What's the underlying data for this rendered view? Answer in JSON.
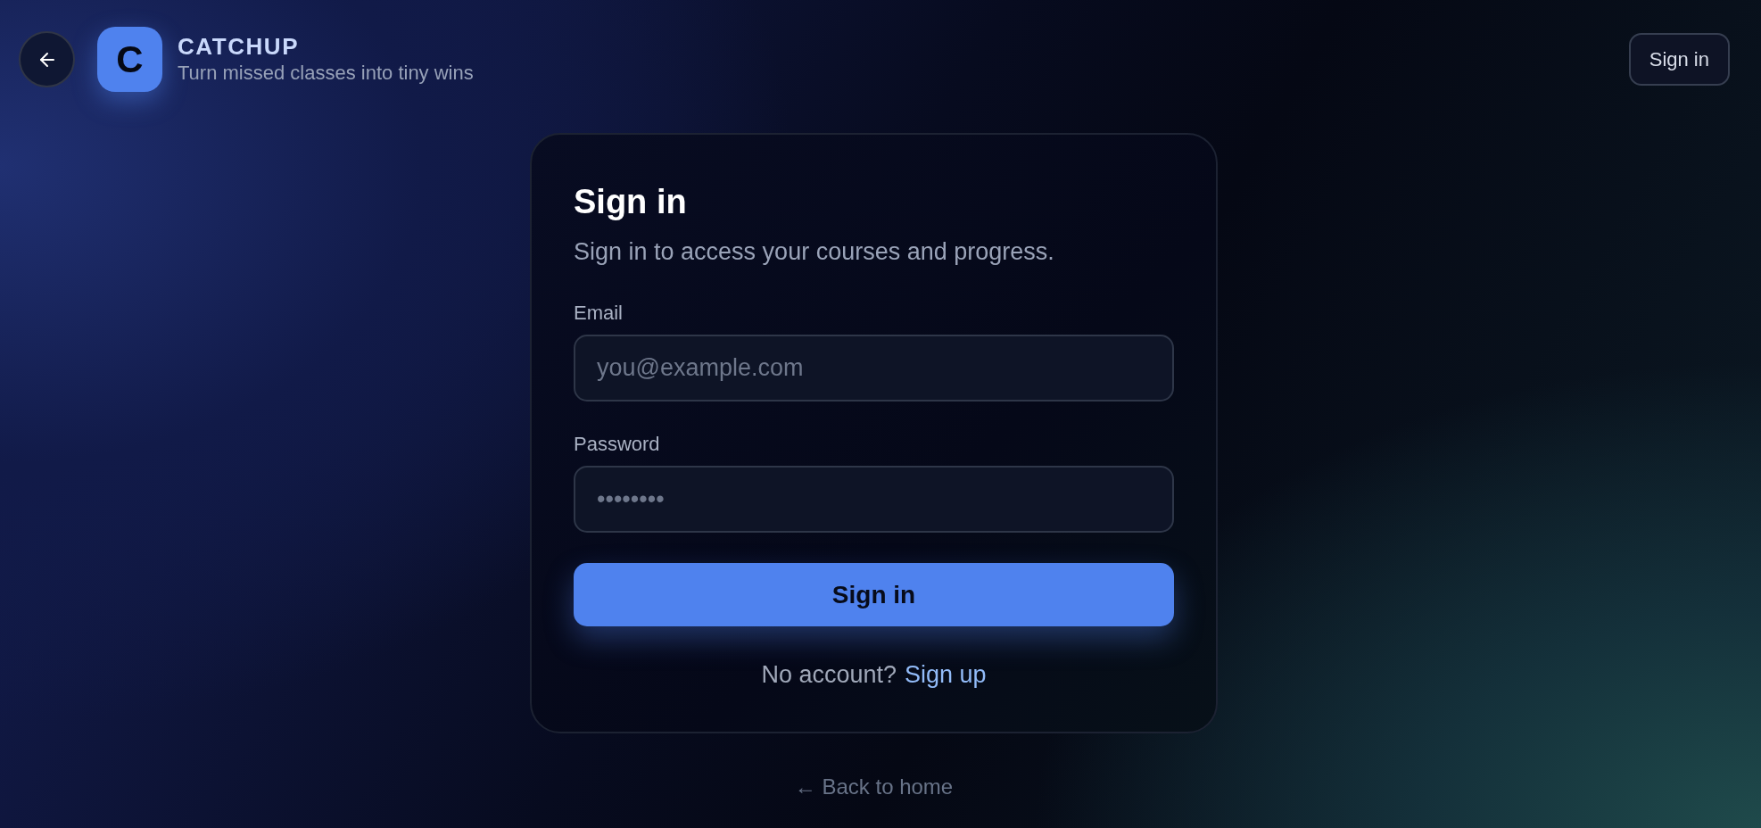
{
  "header": {
    "brand": {
      "logo_letter": "C",
      "name": "CATCHUP",
      "tagline": "Turn missed classes into tiny wins"
    },
    "sign_in_button": "Sign in"
  },
  "card": {
    "title": "Sign in",
    "subtitle": "Sign in to access your courses and progress.",
    "fields": [
      {
        "label": "Email",
        "placeholder": "you@example.com"
      },
      {
        "label": "Password",
        "placeholder": "••••••••"
      }
    ],
    "submit_button": "Sign in",
    "footer": {
      "text": "No account?",
      "link": "Sign up"
    }
  },
  "back_link": "← Back to home"
}
